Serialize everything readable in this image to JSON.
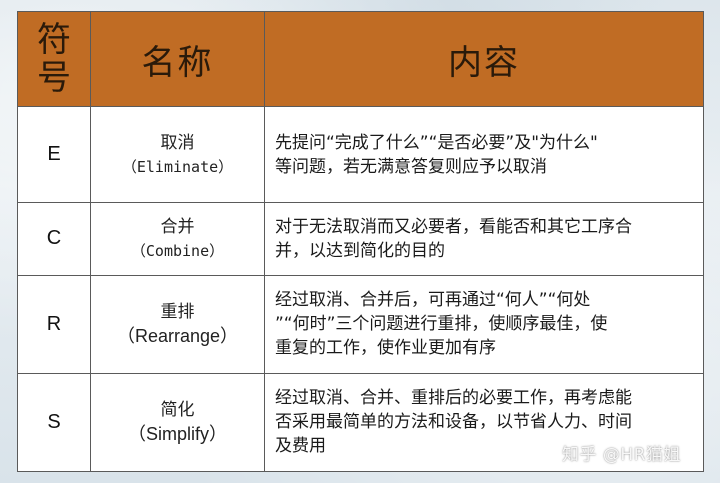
{
  "table": {
    "header": {
      "symbol_line1": "符",
      "symbol_line2": "号",
      "name": "名称",
      "content": "内容"
    },
    "rows": [
      {
        "symbol": "E",
        "name_zh": "取消",
        "name_en": "（Eliminate）",
        "desc_lines": [
          "先提问“完成了什么”“是否必要”及\"为什么\"",
          "等问题，若无满意答复则应予以取消"
        ]
      },
      {
        "symbol": "C",
        "name_zh": "合并",
        "name_en": "（Combine）",
        "desc_lines": [
          "对于无法取消而又必要者，看能否和其它工序合",
          "并，以达到简化的目的"
        ]
      },
      {
        "symbol": "R",
        "name_zh": "重排",
        "name_en": "（Rearrange）",
        "desc_lines": [
          "经过取消、合并后，可再通过“何人”“何处",
          "”“何时”三个问题进行重排，使顺序最佳，使",
          "重复的工作，使作业更加有序"
        ]
      },
      {
        "symbol": "S",
        "name_zh": "简化",
        "name_en": "（Simplify）",
        "desc_lines": [
          "经过取消、合并、重排后的必要工作，再考虑能",
          "否采用最简单的方法和设备，以节省人力、时间",
          "及费用"
        ]
      }
    ]
  },
  "watermark": "知乎 @HR猫姐",
  "colors": {
    "header_bg": "#c06c24",
    "border": "#5a5a5a",
    "cell_bg": "#ffffff"
  }
}
